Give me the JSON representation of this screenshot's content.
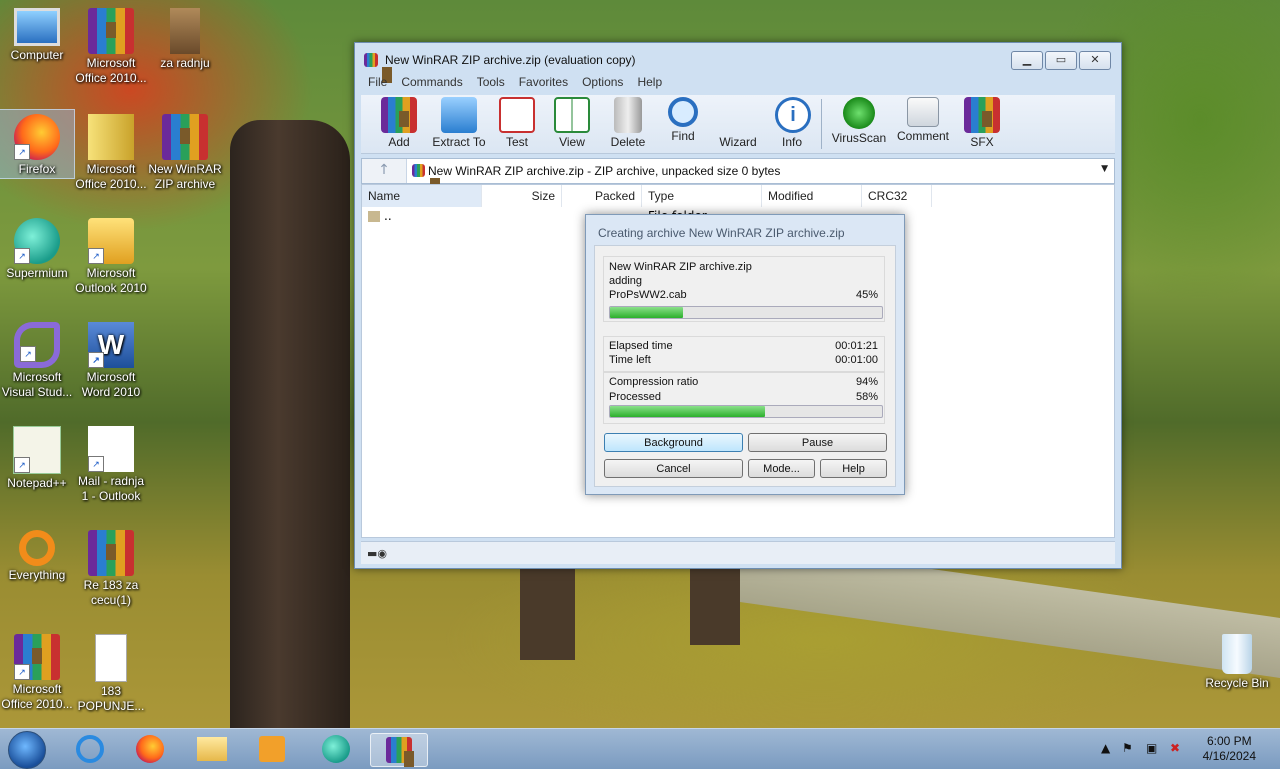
{
  "desktop": {
    "icons": [
      {
        "label": "Computer"
      },
      {
        "label": "Microsoft Office 2010..."
      },
      {
        "label": "za radnju"
      },
      {
        "label": "Firefox"
      },
      {
        "label": "Microsoft Office 2010..."
      },
      {
        "label": "New WinRAR ZIP archive"
      },
      {
        "label": "Supermium"
      },
      {
        "label": "Microsoft Outlook 2010"
      },
      {
        "label": "Microsoft Visual Stud..."
      },
      {
        "label": "Microsoft Word 2010"
      },
      {
        "label": "Notepad++"
      },
      {
        "label": "Mail - radnja 1 - Outlook"
      },
      {
        "label": "Everything"
      },
      {
        "label": "Re 183 za cecu(1)"
      },
      {
        "label": "Microsoft Office 2010..."
      },
      {
        "label": "183 POPUNJE..."
      },
      {
        "label": "Recycle Bin"
      }
    ]
  },
  "window": {
    "title": "New WinRAR ZIP archive.zip (evaluation copy)",
    "menu": [
      "File",
      "Commands",
      "Tools",
      "Favorites",
      "Options",
      "Help"
    ],
    "toolbar": [
      "Add",
      "Extract To",
      "Test",
      "View",
      "Delete",
      "Find",
      "Wizard",
      "Info",
      "VirusScan",
      "Comment",
      "SFX"
    ],
    "address": "New WinRAR ZIP archive.zip - ZIP archive, unpacked size 0 bytes",
    "columns": [
      "Name",
      "Size",
      "Packed",
      "Type",
      "Modified",
      "CRC32"
    ],
    "rows": [
      {
        "name": "..",
        "type": "File folder"
      }
    ]
  },
  "dialog": {
    "title": "Creating archive New WinRAR ZIP archive.zip",
    "archive": "New WinRAR ZIP archive.zip",
    "action": "adding",
    "file": "ProPsWW2.cab",
    "file_percent": "45%",
    "file_progress": 0.27,
    "elapsed_label": "Elapsed time",
    "elapsed_value": "00:01:21",
    "left_label": "Time left",
    "left_value": "00:01:00",
    "ratio_label": "Compression ratio",
    "ratio_value": "94%",
    "processed_label": "Processed",
    "processed_value": "58%",
    "total_progress": 0.57,
    "buttons": {
      "background": "Background",
      "pause": "Pause",
      "cancel": "Cancel",
      "mode": "Mode...",
      "help": "Help"
    }
  },
  "taskbar": {
    "time": "6:00 PM",
    "date": "4/16/2024"
  }
}
